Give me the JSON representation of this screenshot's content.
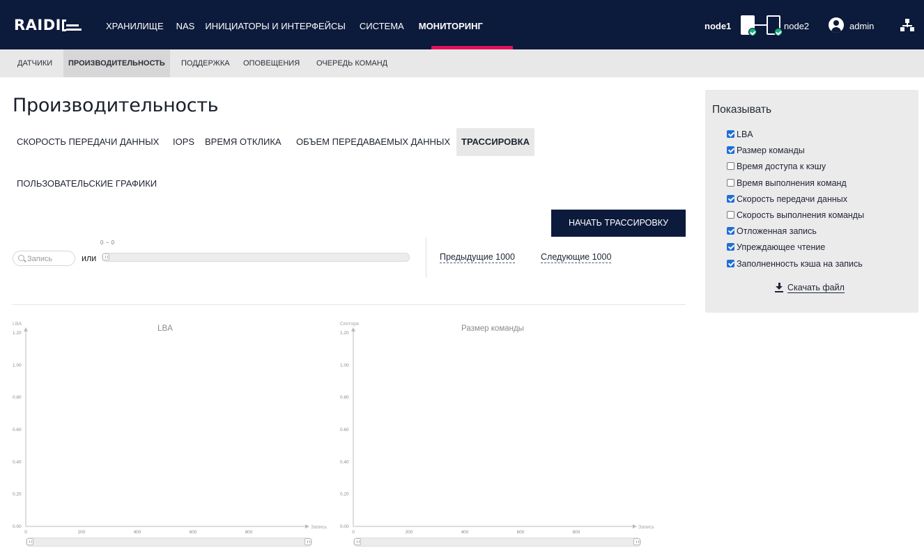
{
  "header": {
    "logo": "RAIDIX",
    "nav": [
      {
        "label": "ХРАНИЛИЩЕ",
        "active": false
      },
      {
        "label": "NAS",
        "active": false
      },
      {
        "label": "ИНИЦИАТОРЫ И ИНТЕРФЕЙСЫ",
        "active": false
      },
      {
        "label": "СИСТЕМА",
        "active": false
      },
      {
        "label": "МОНИТОРИНГ",
        "active": true
      }
    ],
    "node1": "node1",
    "node2": "node2",
    "user": "admin",
    "accent_color": "#e2115d",
    "bg_color": "#0c1a3b"
  },
  "subnav": [
    {
      "label": "ДАТЧИКИ",
      "active": false
    },
    {
      "label": "ПРОИЗВОДИТЕЛЬНОСТЬ",
      "active": true
    },
    {
      "label": "ПОДДЕРЖКА",
      "active": false
    },
    {
      "label": "ОПОВЕЩЕНИЯ",
      "active": false
    },
    {
      "label": "ОЧЕРЕДЬ КОМАНД",
      "active": false
    }
  ],
  "page": {
    "title": "Производительность",
    "tabs": [
      {
        "label": "СКОРОСТЬ ПЕРЕДАЧИ ДАННЫХ",
        "active": false
      },
      {
        "label": "IOPS",
        "active": false
      },
      {
        "label": "ВРЕМЯ ОТКЛИКА",
        "active": false
      },
      {
        "label": "ОБЪЕМ ПЕРЕДАВАЕМЫХ ДАННЫХ",
        "active": false
      },
      {
        "label": "ТРАССИРОВКА",
        "active": true
      },
      {
        "label": "ПОЛЬЗОВАТЕЛЬСКИЕ ГРАФИКИ",
        "active": false
      }
    ],
    "start_trace_button": "НАЧАТЬ ТРАССИРОВКУ",
    "search_placeholder": "Запись",
    "or_label": "или",
    "range_label": "0 − 0",
    "prev_link": "Предыдущие 1000",
    "next_link": "Следующие 1000"
  },
  "panel": {
    "title": "Показывать",
    "options": [
      {
        "label": "LBA",
        "checked": true
      },
      {
        "label": "Размер команды",
        "checked": true
      },
      {
        "label": "Время доступа к кэшу",
        "checked": false
      },
      {
        "label": "Время выполнения команд",
        "checked": false
      },
      {
        "label": "Скорость передачи данных",
        "checked": true
      },
      {
        "label": "Скорость выполнения команды",
        "checked": false
      },
      {
        "label": "Отложенная запись",
        "checked": true
      },
      {
        "label": "Упреждающее чтение",
        "checked": true
      },
      {
        "label": "Заполненность кэша на запись",
        "checked": true
      }
    ],
    "download_link": "Скачать файл"
  },
  "chart_data": [
    {
      "type": "line",
      "title": "LBA",
      "ylabel": "LBA",
      "xlabel": "Запись",
      "x": [],
      "series": [],
      "xlim": [
        0,
        1000
      ],
      "ylim": [
        0,
        1.2
      ],
      "xticks": [
        "0",
        "200",
        "400",
        "600",
        "800"
      ],
      "yticks": [
        "0.00",
        "0.20",
        "0.40",
        "0.60",
        "0.80",
        "1.00",
        "1.20"
      ]
    },
    {
      "type": "line",
      "title": "Размер команды",
      "ylabel": "Сектора",
      "xlabel": "Запись",
      "x": [],
      "series": [],
      "xlim": [
        0,
        1000
      ],
      "ylim": [
        0,
        1.2
      ],
      "xticks": [
        "0",
        "200",
        "400",
        "600",
        "800"
      ],
      "yticks": [
        "0.00",
        "0.20",
        "0.40",
        "0.60",
        "0.80",
        "1.00",
        "1.20"
      ]
    }
  ]
}
